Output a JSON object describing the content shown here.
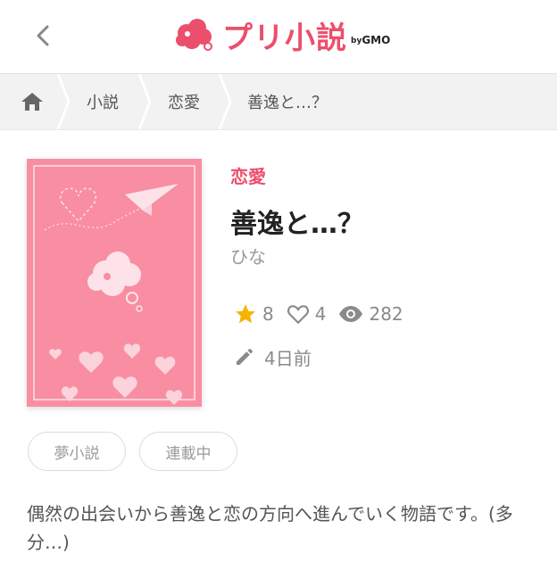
{
  "header": {
    "logo_text": "プリ小説",
    "logo_by": "by",
    "logo_gmo": "GMO"
  },
  "breadcrumb": {
    "items": [
      {
        "label": "小説"
      },
      {
        "label": "恋愛"
      },
      {
        "label": "善逸と…？"
      }
    ]
  },
  "book": {
    "genre": "恋愛",
    "title": "善逸と…？",
    "author": "ひな",
    "stars": "8",
    "likes": "4",
    "views": "282",
    "updated": "4日前"
  },
  "tags": [
    "夢小説",
    "連載中"
  ],
  "description": "偶然の出会いから善逸と恋の方向へ進んでいく物語です。(多分…)",
  "colors": {
    "brand": "#ec4f6b",
    "cover": "#f98ea3",
    "star": "#f5b400"
  }
}
